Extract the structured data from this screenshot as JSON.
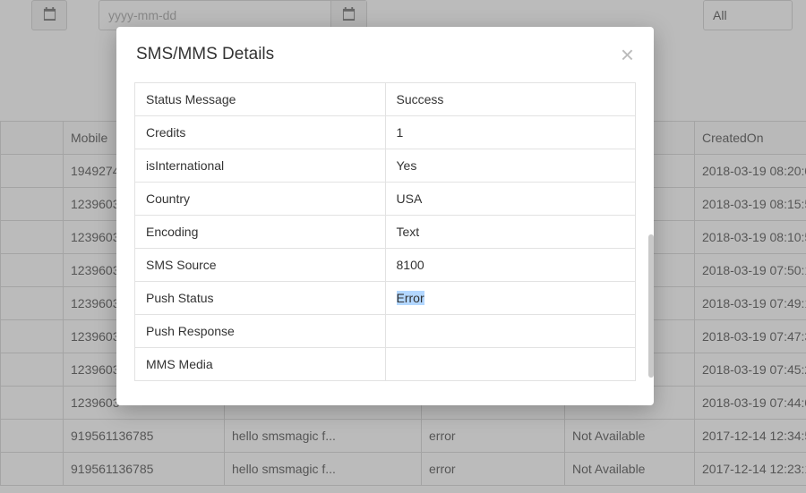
{
  "filters": {
    "date_placeholder": "yyyy-mm-dd",
    "all_label": "All"
  },
  "grid": {
    "headers": {
      "mobile": "Mobile",
      "created": "CreatedOn"
    },
    "rows": [
      {
        "mobile": "1949274",
        "msg": "",
        "status": "",
        "avail": "",
        "created": "2018-03-19 08:20:0"
      },
      {
        "mobile": "1239603",
        "msg": "",
        "status": "",
        "avail": "",
        "created": "2018-03-19 08:15:5"
      },
      {
        "mobile": "1239603",
        "msg": "",
        "status": "",
        "avail": "",
        "created": "2018-03-19 08:10:5"
      },
      {
        "mobile": "1239603",
        "msg": "",
        "status": "",
        "avail": "",
        "created": "2018-03-19 07:50:1"
      },
      {
        "mobile": "1239603",
        "msg": "",
        "status": "",
        "avail": "",
        "created": "2018-03-19 07:49:1"
      },
      {
        "mobile": "1239603",
        "msg": "",
        "status": "",
        "avail": "",
        "created": "2018-03-19 07:47:3"
      },
      {
        "mobile": "1239603",
        "msg": "",
        "status": "",
        "avail": "",
        "created": "2018-03-19 07:45:2"
      },
      {
        "mobile": "1239603",
        "msg": "",
        "status": "",
        "avail": "",
        "created": "2018-03-19 07:44:0"
      },
      {
        "mobile": "919561136785",
        "msg": "hello smsmagic f...",
        "status": "error",
        "avail": "Not Available",
        "created": "2017-12-14 12:34:5"
      },
      {
        "mobile": "919561136785",
        "msg": "hello smsmagic f...",
        "status": "error",
        "avail": "Not Available",
        "created": "2017-12-14 12:23:1"
      }
    ]
  },
  "modal": {
    "title": "SMS/MMS Details",
    "rows": {
      "status_message": {
        "label": "Status Message",
        "value": "Success"
      },
      "credits": {
        "label": "Credits",
        "value": "1"
      },
      "is_international": {
        "label": "isInternational",
        "value": "Yes"
      },
      "country": {
        "label": "Country",
        "value": "USA"
      },
      "encoding": {
        "label": "Encoding",
        "value": "Text"
      },
      "sms_source": {
        "label": "SMS Source",
        "value": "8100"
      },
      "push_status": {
        "label": "Push Status",
        "value": "Error"
      },
      "push_response": {
        "label": "Push Response",
        "value": ""
      },
      "mms_media": {
        "label": "MMS Media",
        "value": ""
      }
    }
  }
}
